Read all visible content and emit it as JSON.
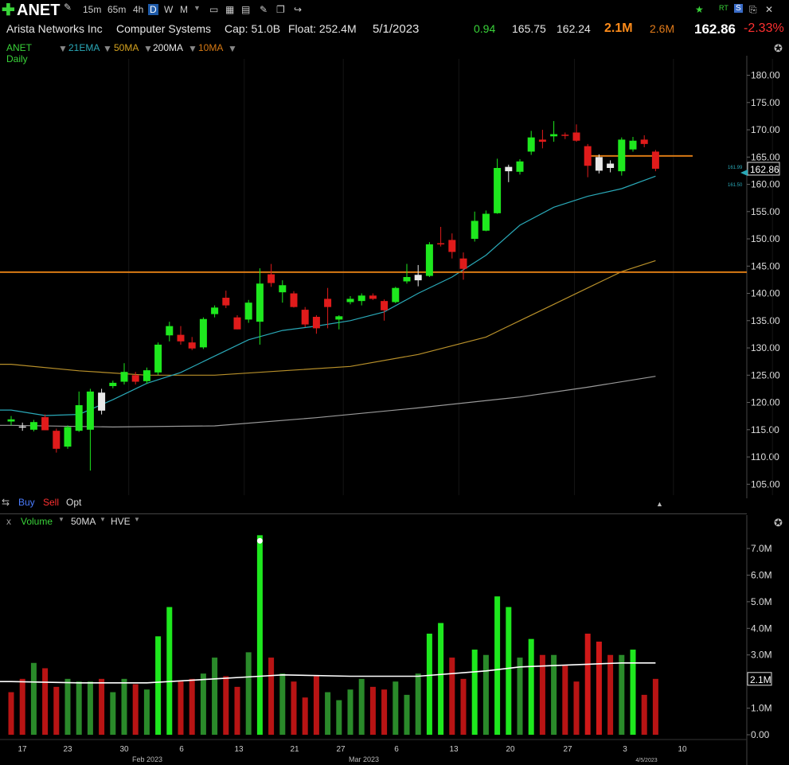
{
  "toolbar": {
    "ticker": "ANET",
    "timeframes": [
      "15m",
      "65m",
      "4h",
      "D",
      "W",
      "M"
    ],
    "active_timeframe": "D",
    "add_icon": "plus-icon"
  },
  "info": {
    "company": "Arista Networks Inc",
    "sector": "Computer Systems",
    "cap": "Cap: 51.0B",
    "float": "Float: 252.4M",
    "date": "5/1/2023",
    "val1": "0.94",
    "val2": "165.75",
    "val3": "162.24",
    "vol": "2.1M",
    "avgvol": "2.6M",
    "last": "162.86",
    "change": "-2.33%"
  },
  "studies": {
    "chart_name": "ANET Daily",
    "ema21": "21EMA",
    "ma50": "50MA",
    "ma200": "200MA",
    "ma10": "10MA"
  },
  "order": {
    "buy": "Buy",
    "sell": "Sell",
    "opt": "Opt"
  },
  "volume_header": {
    "close": "x",
    "volume": "Volume",
    "ma": "50MA",
    "hve": "HVE"
  },
  "colors": {
    "up": "#1ee81e",
    "down": "#e01b1b",
    "neutral": "#e8e8e8",
    "ema21": "#2aa9b8",
    "ma50": "#b8902a",
    "ma200": "#9a9a9a",
    "level": "#d87a14"
  },
  "chart_data": {
    "type": "candlestick",
    "title": "ANET Daily",
    "ylim": [
      103,
      183
    ],
    "y_ticks": [
      "180.00",
      "175.00",
      "170.00",
      "165.00",
      "160.00",
      "155.00",
      "150.00",
      "145.00",
      "140.00",
      "135.00",
      "130.00",
      "125.00",
      "120.00",
      "115.00",
      "110.00",
      "105.00"
    ],
    "y_tick_values": [
      180,
      175,
      170,
      165,
      160,
      155,
      150,
      145,
      140,
      135,
      130,
      125,
      120,
      115,
      110,
      105
    ],
    "x_labels": [
      "17",
      "23",
      "30",
      "6",
      "13",
      "21",
      "27",
      "6",
      "13",
      "20",
      "27",
      "3",
      "10"
    ],
    "x_sublabels": [
      "Feb 2023",
      "Mar 2023",
      "4/5/2023"
    ],
    "last_price_label": "162.86",
    "ema_labels": [
      "161.99",
      "161.50"
    ],
    "horizontal_levels": [
      143.9,
      165.2
    ],
    "candles": [
      {
        "o": 116.5,
        "h": 117.5,
        "l": 115.8,
        "c": 116.9,
        "d": "up"
      },
      {
        "o": 115.6,
        "h": 116.3,
        "l": 114.8,
        "c": 115.6,
        "d": "neutral"
      },
      {
        "o": 115.0,
        "h": 116.8,
        "l": 114.7,
        "c": 116.4,
        "d": "up"
      },
      {
        "o": 117.3,
        "h": 117.8,
        "l": 114.9,
        "c": 114.9,
        "d": "down"
      },
      {
        "o": 114.8,
        "h": 115.2,
        "l": 110.8,
        "c": 111.5,
        "d": "down"
      },
      {
        "o": 111.9,
        "h": 115.8,
        "l": 111.5,
        "c": 115.5,
        "d": "up"
      },
      {
        "o": 114.8,
        "h": 122.0,
        "l": 114.6,
        "c": 119.5,
        "d": "up"
      },
      {
        "o": 115.0,
        "h": 122.5,
        "l": 107.5,
        "c": 122.0,
        "d": "up"
      },
      {
        "o": 118.5,
        "h": 122.5,
        "l": 117.8,
        "c": 121.8,
        "d": "neutral"
      },
      {
        "o": 123.0,
        "h": 124.0,
        "l": 122.6,
        "c": 123.6,
        "d": "up"
      },
      {
        "o": 123.8,
        "h": 127.2,
        "l": 123.3,
        "c": 125.6,
        "d": "up"
      },
      {
        "o": 125.0,
        "h": 125.6,
        "l": 123.3,
        "c": 123.8,
        "d": "down"
      },
      {
        "o": 123.9,
        "h": 126.4,
        "l": 123.4,
        "c": 125.9,
        "d": "up"
      },
      {
        "o": 125.5,
        "h": 131.0,
        "l": 125.0,
        "c": 130.6,
        "d": "up"
      },
      {
        "o": 132.3,
        "h": 134.8,
        "l": 131.2,
        "c": 134.0,
        "d": "up"
      },
      {
        "o": 132.4,
        "h": 134.0,
        "l": 130.6,
        "c": 131.2,
        "d": "down"
      },
      {
        "o": 131.0,
        "h": 132.0,
        "l": 129.6,
        "c": 129.9,
        "d": "down"
      },
      {
        "o": 130.1,
        "h": 135.6,
        "l": 129.8,
        "c": 135.3,
        "d": "up"
      },
      {
        "o": 136.2,
        "h": 137.8,
        "l": 135.6,
        "c": 137.4,
        "d": "up"
      },
      {
        "o": 139.2,
        "h": 140.5,
        "l": 137.3,
        "c": 137.8,
        "d": "down"
      },
      {
        "o": 135.6,
        "h": 136.0,
        "l": 133.4,
        "c": 133.4,
        "d": "down"
      },
      {
        "o": 135.2,
        "h": 138.8,
        "l": 134.6,
        "c": 138.3,
        "d": "up"
      },
      {
        "o": 134.8,
        "h": 144.6,
        "l": 130.6,
        "c": 141.8,
        "d": "up"
      },
      {
        "o": 143.5,
        "h": 145.4,
        "l": 141.2,
        "c": 141.9,
        "d": "down"
      },
      {
        "o": 140.2,
        "h": 142.4,
        "l": 138.3,
        "c": 141.5,
        "d": "up"
      },
      {
        "o": 140.0,
        "h": 140.4,
        "l": 137.4,
        "c": 137.5,
        "d": "down"
      },
      {
        "o": 137.0,
        "h": 137.5,
        "l": 133.8,
        "c": 134.3,
        "d": "down"
      },
      {
        "o": 133.6,
        "h": 136.0,
        "l": 132.6,
        "c": 135.7,
        "d": "down"
      },
      {
        "o": 139.0,
        "h": 141.0,
        "l": 133.6,
        "c": 137.5,
        "d": "down"
      },
      {
        "o": 135.2,
        "h": 136.0,
        "l": 133.4,
        "c": 135.8,
        "d": "up"
      },
      {
        "o": 138.4,
        "h": 139.5,
        "l": 138.0,
        "c": 139.0,
        "d": "up"
      },
      {
        "o": 138.6,
        "h": 140.0,
        "l": 137.8,
        "c": 139.6,
        "d": "up"
      },
      {
        "o": 139.6,
        "h": 140.0,
        "l": 138.8,
        "c": 139.0,
        "d": "down"
      },
      {
        "o": 138.6,
        "h": 138.9,
        "l": 135.0,
        "c": 136.9,
        "d": "down"
      },
      {
        "o": 138.4,
        "h": 141.2,
        "l": 138.2,
        "c": 141.0,
        "d": "up"
      },
      {
        "o": 142.2,
        "h": 145.4,
        "l": 141.8,
        "c": 143.0,
        "d": "up"
      },
      {
        "o": 142.4,
        "h": 145.2,
        "l": 141.3,
        "c": 143.4,
        "d": "neutral"
      },
      {
        "o": 143.2,
        "h": 149.4,
        "l": 143.0,
        "c": 149.0,
        "d": "up"
      },
      {
        "o": 149.0,
        "h": 152.2,
        "l": 148.6,
        "c": 149.2,
        "d": "down"
      },
      {
        "o": 149.8,
        "h": 151.0,
        "l": 146.4,
        "c": 147.6,
        "d": "down"
      },
      {
        "o": 146.4,
        "h": 147.5,
        "l": 142.5,
        "c": 144.5,
        "d": "down"
      },
      {
        "o": 150.0,
        "h": 155.0,
        "l": 149.5,
        "c": 153.3,
        "d": "up"
      },
      {
        "o": 151.5,
        "h": 155.2,
        "l": 151.4,
        "c": 154.6,
        "d": "up"
      },
      {
        "o": 154.7,
        "h": 164.7,
        "l": 154.6,
        "c": 163.0,
        "d": "up"
      },
      {
        "o": 162.4,
        "h": 163.6,
        "l": 160.4,
        "c": 163.2,
        "d": "neutral"
      },
      {
        "o": 162.3,
        "h": 164.6,
        "l": 161.8,
        "c": 164.2,
        "d": "up"
      },
      {
        "o": 166.0,
        "h": 169.8,
        "l": 165.4,
        "c": 168.6,
        "d": "up"
      },
      {
        "o": 168.2,
        "h": 170.0,
        "l": 166.6,
        "c": 167.8,
        "d": "down"
      },
      {
        "o": 168.8,
        "h": 171.6,
        "l": 167.8,
        "c": 169.2,
        "d": "up"
      },
      {
        "o": 169.0,
        "h": 169.5,
        "l": 168.3,
        "c": 169.1,
        "d": "down"
      },
      {
        "o": 169.5,
        "h": 171.0,
        "l": 167.8,
        "c": 168.0,
        "d": "down"
      },
      {
        "o": 167.0,
        "h": 167.4,
        "l": 161.3,
        "c": 163.4,
        "d": "down"
      },
      {
        "o": 165.0,
        "h": 165.5,
        "l": 162.0,
        "c": 162.5,
        "d": "neutral"
      },
      {
        "o": 163.0,
        "h": 164.4,
        "l": 162.2,
        "c": 163.8,
        "d": "neutral"
      },
      {
        "o": 162.4,
        "h": 168.6,
        "l": 161.6,
        "c": 168.2,
        "d": "up"
      },
      {
        "o": 166.4,
        "h": 168.7,
        "l": 166.0,
        "c": 168.0,
        "d": "up"
      },
      {
        "o": 168.2,
        "h": 169.0,
        "l": 166.8,
        "c": 167.4,
        "d": "down"
      },
      {
        "o": 166.0,
        "h": 166.3,
        "l": 162.4,
        "c": 162.86,
        "d": "down"
      }
    ],
    "ema21": [
      [
        0,
        118.6
      ],
      [
        3,
        117.6
      ],
      [
        6,
        117.8
      ],
      [
        9,
        120.5
      ],
      [
        12,
        123.5
      ],
      [
        15,
        125.5
      ],
      [
        18,
        128.5
      ],
      [
        21,
        131.5
      ],
      [
        24,
        133.2
      ],
      [
        27,
        134.0
      ],
      [
        30,
        135.0
      ],
      [
        33,
        136.6
      ],
      [
        36,
        140.0
      ],
      [
        39,
        143.0
      ],
      [
        42,
        147.0
      ],
      [
        45,
        152.5
      ],
      [
        48,
        155.8
      ],
      [
        51,
        157.8
      ],
      [
        54,
        159.2
      ],
      [
        57,
        161.5
      ]
    ],
    "ma50": [
      [
        0,
        127.0
      ],
      [
        6,
        125.8
      ],
      [
        12,
        125.0
      ],
      [
        18,
        125.0
      ],
      [
        24,
        125.8
      ],
      [
        30,
        126.6
      ],
      [
        36,
        128.8
      ],
      [
        42,
        132.0
      ],
      [
        45,
        135.0
      ],
      [
        48,
        138.0
      ],
      [
        51,
        141.0
      ],
      [
        54,
        144.0
      ],
      [
        57,
        146.0
      ]
    ],
    "ma200": [
      [
        0,
        115.8
      ],
      [
        9,
        115.5
      ],
      [
        18,
        115.7
      ],
      [
        27,
        117.2
      ],
      [
        36,
        119.0
      ],
      [
        45,
        121.0
      ],
      [
        51,
        122.8
      ],
      [
        57,
        124.8
      ]
    ],
    "volume": {
      "ylim": [
        0,
        7.6
      ],
      "y_ticks": [
        "7.0M",
        "6.0M",
        "5.0M",
        "4.0M",
        "3.0M",
        "2.0M",
        "1.0M",
        "0.00"
      ],
      "y_tick_values": [
        7,
        6,
        5,
        4,
        3,
        2,
        1,
        0
      ],
      "last_label": "2.1M",
      "bars": [
        {
          "v": 1.6,
          "d": "down"
        },
        {
          "v": 2.1,
          "d": "down"
        },
        {
          "v": 2.7,
          "d": "up"
        },
        {
          "v": 2.5,
          "d": "down"
        },
        {
          "v": 1.8,
          "d": "down"
        },
        {
          "v": 2.1,
          "d": "up"
        },
        {
          "v": 2.0,
          "d": "up"
        },
        {
          "v": 2.0,
          "d": "up"
        },
        {
          "v": 2.1,
          "d": "down"
        },
        {
          "v": 1.6,
          "d": "up"
        },
        {
          "v": 2.1,
          "d": "up"
        },
        {
          "v": 1.9,
          "d": "down"
        },
        {
          "v": 1.7,
          "d": "up"
        },
        {
          "v": 3.7,
          "d": "up"
        },
        {
          "v": 4.8,
          "d": "up"
        },
        {
          "v": 2.0,
          "d": "down"
        },
        {
          "v": 2.1,
          "d": "down"
        },
        {
          "v": 2.3,
          "d": "up"
        },
        {
          "v": 2.9,
          "d": "up"
        },
        {
          "v": 2.2,
          "d": "down"
        },
        {
          "v": 1.8,
          "d": "down"
        },
        {
          "v": 3.1,
          "d": "up"
        },
        {
          "v": 7.5,
          "d": "up"
        },
        {
          "v": 2.9,
          "d": "down"
        },
        {
          "v": 2.3,
          "d": "up"
        },
        {
          "v": 2.0,
          "d": "down"
        },
        {
          "v": 1.4,
          "d": "down"
        },
        {
          "v": 2.2,
          "d": "down"
        },
        {
          "v": 1.6,
          "d": "up"
        },
        {
          "v": 1.3,
          "d": "up"
        },
        {
          "v": 1.7,
          "d": "up"
        },
        {
          "v": 2.1,
          "d": "up"
        },
        {
          "v": 1.8,
          "d": "down"
        },
        {
          "v": 1.7,
          "d": "down"
        },
        {
          "v": 2.0,
          "d": "up"
        },
        {
          "v": 1.5,
          "d": "up"
        },
        {
          "v": 2.3,
          "d": "up"
        },
        {
          "v": 3.8,
          "d": "up"
        },
        {
          "v": 4.2,
          "d": "up"
        },
        {
          "v": 2.9,
          "d": "down"
        },
        {
          "v": 2.1,
          "d": "down"
        },
        {
          "v": 3.2,
          "d": "up"
        },
        {
          "v": 3.0,
          "d": "up"
        },
        {
          "v": 5.2,
          "d": "up"
        },
        {
          "v": 4.8,
          "d": "up"
        },
        {
          "v": 2.9,
          "d": "up"
        },
        {
          "v": 3.6,
          "d": "up"
        },
        {
          "v": 3.0,
          "d": "down"
        },
        {
          "v": 3.0,
          "d": "up"
        },
        {
          "v": 2.6,
          "d": "down"
        },
        {
          "v": 2.0,
          "d": "down"
        },
        {
          "v": 3.8,
          "d": "down"
        },
        {
          "v": 3.5,
          "d": "down"
        },
        {
          "v": 3.0,
          "d": "down"
        },
        {
          "v": 3.0,
          "d": "up"
        },
        {
          "v": 3.2,
          "d": "up"
        },
        {
          "v": 1.5,
          "d": "down"
        },
        {
          "v": 2.1,
          "d": "down"
        }
      ],
      "ma50": [
        [
          0,
          2.0
        ],
        [
          6,
          1.95
        ],
        [
          12,
          1.95
        ],
        [
          18,
          2.1
        ],
        [
          22,
          2.2
        ],
        [
          24,
          2.25
        ],
        [
          30,
          2.2
        ],
        [
          36,
          2.2
        ],
        [
          42,
          2.4
        ],
        [
          45,
          2.55
        ],
        [
          48,
          2.6
        ],
        [
          51,
          2.65
        ],
        [
          54,
          2.7
        ],
        [
          57,
          2.7
        ]
      ]
    }
  }
}
